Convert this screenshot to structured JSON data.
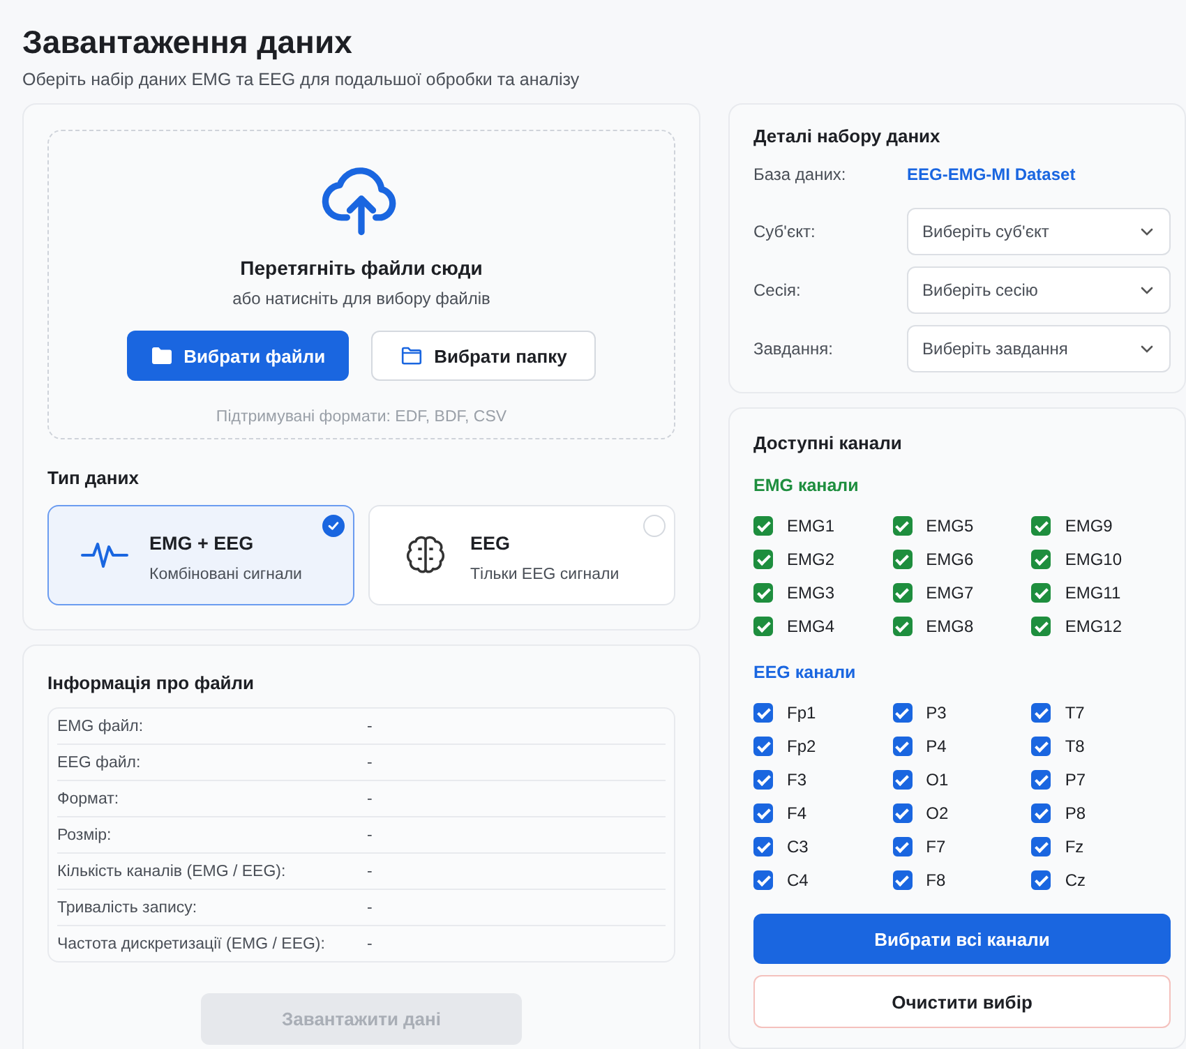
{
  "title": "Завантаження даних",
  "subtitle": "Оберіть набір даних EMG та EEG для подальшої обробки та аналізу",
  "dropzone": {
    "heading": "Перетягніть файли сюди",
    "hint": "або натисніть для вибору файлів",
    "buttons": [
      {
        "label": "Вибрати файли",
        "kind": "primary"
      },
      {
        "label": "Вибрати папку",
        "kind": "secondary"
      }
    ],
    "formats": "Підтримувані формати: EDF, BDF, CSV"
  },
  "data_type": {
    "label": "Тип даних",
    "options": [
      {
        "title": "EMG + EEG",
        "subtitle": "Комбіновані сигнали",
        "kind": "wave",
        "selected": true
      },
      {
        "title": "EEG",
        "subtitle": "Тільки EEG сигнали",
        "kind": "brain",
        "selected": false
      }
    ]
  },
  "file_info": {
    "title": "Інформація про файли",
    "rows": [
      {
        "label": "EMG файл:",
        "value": "-"
      },
      {
        "label": "EEG файл:",
        "value": "-"
      },
      {
        "label": "Формат:",
        "value": "-"
      },
      {
        "label": "Розмір:",
        "value": "-"
      },
      {
        "label": "Кількість каналів (EMG / EEG):",
        "value": "-"
      },
      {
        "label": "Тривалість запису:",
        "value": "-"
      },
      {
        "label": "Частота дискретизації (EMG / EEG):",
        "value": "-"
      }
    ],
    "upload_button": {
      "label": "Завантажити дані",
      "disabled": true
    }
  },
  "dataset": {
    "title": "Деталі набору даних",
    "database_label": "База даних:",
    "database_value": "EEG-EMG-MI Dataset",
    "selects": [
      {
        "label": "Суб'єкт:",
        "placeholder": "Виберіть суб'єкт"
      },
      {
        "label": "Сесія:",
        "placeholder": "Виберіть сесію"
      },
      {
        "label": "Завдання:",
        "placeholder": "Виберіть завдання"
      }
    ]
  },
  "channels": {
    "title": "Доступні канали",
    "groups": [
      {
        "label": "EMG канали",
        "color": "#1e8e3e",
        "items": [
          {
            "name": "EMG1",
            "checked": true
          },
          {
            "name": "EMG2",
            "checked": true
          },
          {
            "name": "EMG3",
            "checked": true
          },
          {
            "name": "EMG4",
            "checked": true
          },
          {
            "name": "EMG5",
            "checked": true
          },
          {
            "name": "EMG6",
            "checked": true
          },
          {
            "name": "EMG7",
            "checked": true
          },
          {
            "name": "EMG8",
            "checked": true
          },
          {
            "name": "EMG9",
            "checked": true
          },
          {
            "name": "EMG10",
            "checked": true
          },
          {
            "name": "EMG11",
            "checked": true
          },
          {
            "name": "EMG12",
            "checked": true
          }
        ]
      },
      {
        "label": "EEG канали",
        "color": "#1a66e0",
        "items": [
          {
            "name": "Fp1",
            "checked": true
          },
          {
            "name": "Fp2",
            "checked": true
          },
          {
            "name": "F3",
            "checked": true
          },
          {
            "name": "F4",
            "checked": true
          },
          {
            "name": "C3",
            "checked": true
          },
          {
            "name": "C4",
            "checked": true
          },
          {
            "name": "P3",
            "checked": true
          },
          {
            "name": "P4",
            "checked": true
          },
          {
            "name": "O1",
            "checked": true
          },
          {
            "name": "O2",
            "checked": true
          },
          {
            "name": "F7",
            "checked": true
          },
          {
            "name": "F8",
            "checked": true
          },
          {
            "name": "T7",
            "checked": true
          },
          {
            "name": "T8",
            "checked": true
          },
          {
            "name": "P7",
            "checked": true
          },
          {
            "name": "P8",
            "checked": true
          },
          {
            "name": "Fz",
            "checked": true
          },
          {
            "name": "Cz",
            "checked": true
          }
        ]
      }
    ],
    "select_all": "Вибрати всі канали",
    "clear": "Очистити вибір"
  }
}
